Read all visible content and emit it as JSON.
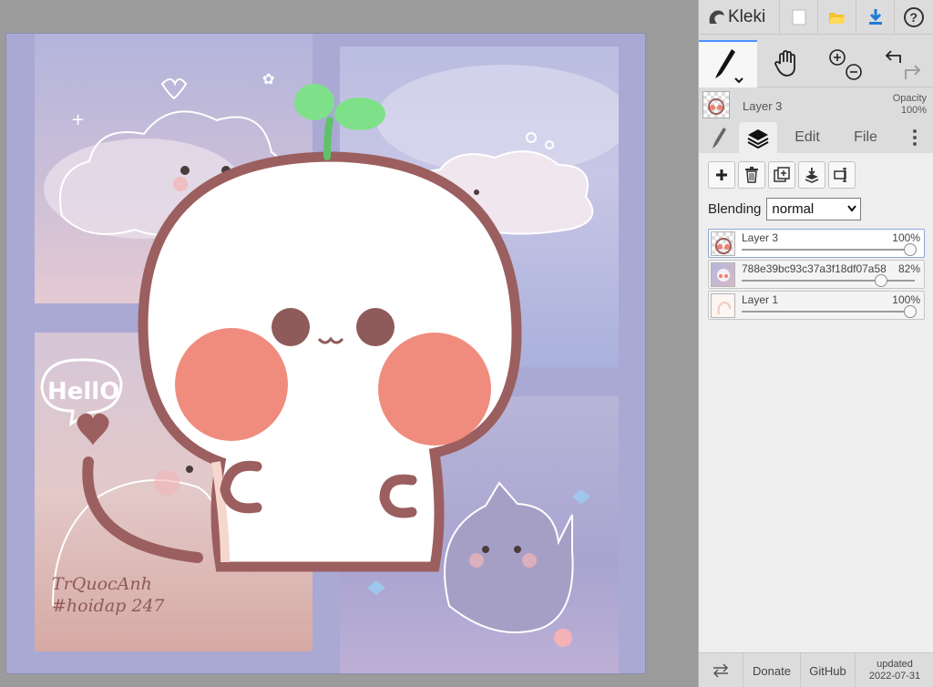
{
  "app": {
    "name": "Kleki"
  },
  "topbar": {
    "icons": [
      "new-image-icon",
      "open-folder-icon",
      "download-icon",
      "help-icon"
    ]
  },
  "tools": {
    "items": [
      "brush-tool-icon",
      "hand-tool-icon",
      "zoom-in-icon",
      "zoom-out-icon",
      "undo-icon",
      "redo-icon"
    ]
  },
  "current_layer": {
    "name": "Layer 3",
    "opacity_label": "Opacity",
    "opacity_value": "100%"
  },
  "tabs": {
    "edit": "Edit",
    "file": "File"
  },
  "layers_panel": {
    "blending_label": "Blending",
    "blending_value": "normal",
    "layers": [
      {
        "name": "Layer 3",
        "opacity": "100%",
        "level": 1.0
      },
      {
        "name": "788e39bc93c37a3f18df07a58",
        "opacity": "82%",
        "level": 0.82
      },
      {
        "name": "Layer 1",
        "opacity": "100%",
        "level": 1.0
      }
    ]
  },
  "footer": {
    "donate": "Donate",
    "github": "GitHub",
    "updated_label": "updated",
    "updated_date": "2022-07-31"
  },
  "artwork": {
    "signature_line1": "TrQuocAnh",
    "signature_line2": "#hoidap 247",
    "speech_text": "HellO"
  },
  "colors": {
    "accent": "#4d90fe",
    "canvas_bg": "#a9a9d4",
    "character_outline": "#9b5f5f",
    "cheek": "#ee8070",
    "sprout": "#7fe08a"
  }
}
